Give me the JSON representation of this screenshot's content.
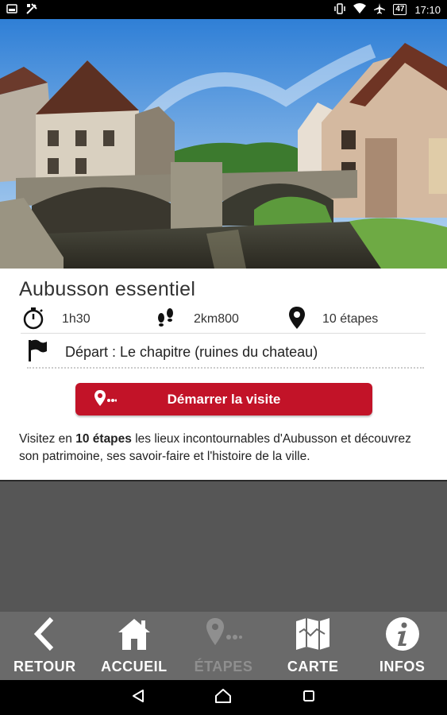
{
  "status_bar": {
    "battery": "47",
    "time": "17:10"
  },
  "tour": {
    "title": "Aubusson essentiel",
    "duration": "1h30",
    "distance": "2km800",
    "steps": "10 étapes",
    "departure": "Départ : Le chapitre (ruines du chateau)",
    "start_button": "Démarrer la visite",
    "description_prefix": "Visitez en ",
    "description_bold": "10 étapes",
    "description_suffix": " les lieux incontournables d'Aubusson et découvrez son patrimoine, ses savoir-faire et l'histoire de la ville."
  },
  "bottom_nav": {
    "items": [
      {
        "label": "RETOUR",
        "icon": "chevron-left-icon"
      },
      {
        "label": "ACCUEIL",
        "icon": "home-icon"
      },
      {
        "label": "ÉTAPES",
        "icon": "steps-pin-icon"
      },
      {
        "label": "CARTE",
        "icon": "map-icon"
      },
      {
        "label": "INFOS",
        "icon": "info-icon"
      }
    ]
  },
  "colors": {
    "accent": "#c21328",
    "nav_bg": "#6a6a6a",
    "content_bg": "#565656"
  }
}
